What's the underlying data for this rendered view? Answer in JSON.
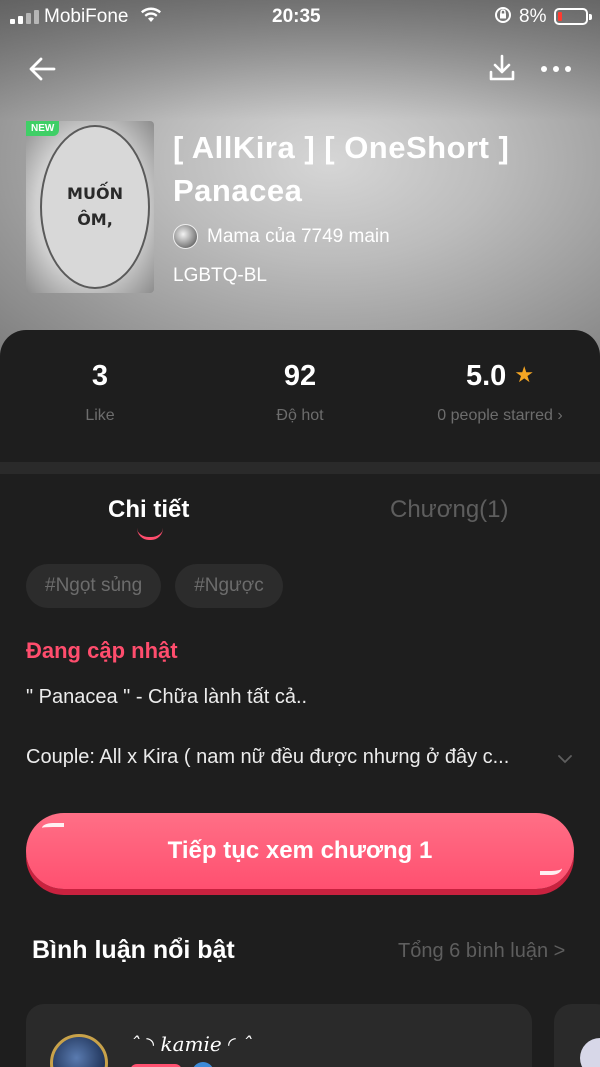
{
  "status_bar": {
    "carrier": "MobiFone",
    "time": "20:35",
    "battery_pct": "8%",
    "battery_color": "#ff3b30"
  },
  "nav": {
    "back_icon": "arrow-left-icon",
    "download_icon": "download-icon",
    "more_icon": "more-dots-icon"
  },
  "story": {
    "badge": "NEW",
    "cover_text_line1": "MUỐN",
    "cover_text_line2": "ÔM,",
    "title_line1": "[ AllKira ] [ OneShort ]",
    "title_line2": "Panacea",
    "author": "Mama của 7749 main",
    "genre": "LGBTQ-BL"
  },
  "stats": {
    "likes_value": "3",
    "likes_label": "Like",
    "hot_value": "92",
    "hot_label": "Độ hot",
    "rating_value": "5.0",
    "rating_label": "0 people starred ›"
  },
  "tabs": {
    "details": "Chi tiết",
    "chapters": "Chương(1)"
  },
  "tags": [
    "#Ngọt sủng",
    "#Ngược"
  ],
  "details": {
    "status": "Đang cập nhật",
    "desc_line1": "\" Panacea \" - Chữa lành tất cả..",
    "desc_line2": "Couple: All x Kira ( nam nữ đều được nhưng ở đây c..."
  },
  "cta": {
    "label": "Tiếp tục xem chương 1",
    "color": "#ff5070"
  },
  "comments": {
    "heading": "Bình luận nổi bật",
    "total": "Tổng 6 bình luận >",
    "first_name": "ˆ ͏◝ kamie ◜ ˆ"
  },
  "accent_color": "#ff4d6d"
}
